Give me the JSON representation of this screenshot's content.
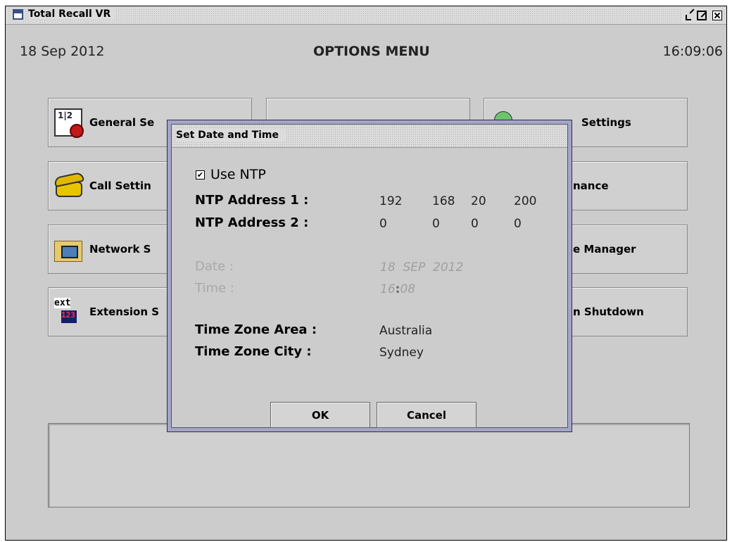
{
  "window": {
    "title": "Total Recall VR",
    "date": "18 Sep 2012",
    "heading": "OPTIONS MENU",
    "time": "16:09:06"
  },
  "menu": {
    "items": [
      {
        "label": "General Se",
        "icon": "calendar-clock-icon"
      },
      {
        "label": "Call Settin",
        "icon": "phone-icon"
      },
      {
        "label": "Network S",
        "icon": "network-folder-icon"
      },
      {
        "label": "Extension S",
        "icon": "extension-icon"
      },
      {
        "label": "Settings",
        "icon": "disc-icon"
      },
      {
        "label": "nance",
        "icon": ""
      },
      {
        "label": "e Manager",
        "icon": ""
      },
      {
        "label": "n Shutdown",
        "icon": ""
      }
    ]
  },
  "dialog": {
    "title": "Set Date and Time",
    "use_ntp_label": "Use NTP",
    "use_ntp_checked": true,
    "ntp1_label": "NTP Address 1 :",
    "ntp1": [
      "192",
      "168",
      "20",
      "200"
    ],
    "ntp2_label": "NTP Address 2 :",
    "ntp2": [
      "0",
      "0",
      "0",
      "0"
    ],
    "date_label": "Date :",
    "date_value": "18  SEP  2012",
    "time_label": "Time :",
    "time_hour": "16",
    "time_sep": ":",
    "time_min": "08",
    "tz_area_label": "Time Zone Area :",
    "tz_area": "Australia",
    "tz_city_label": "Time Zone City :",
    "tz_city": "Sydney",
    "ok_label": "OK",
    "cancel_label": "Cancel"
  }
}
